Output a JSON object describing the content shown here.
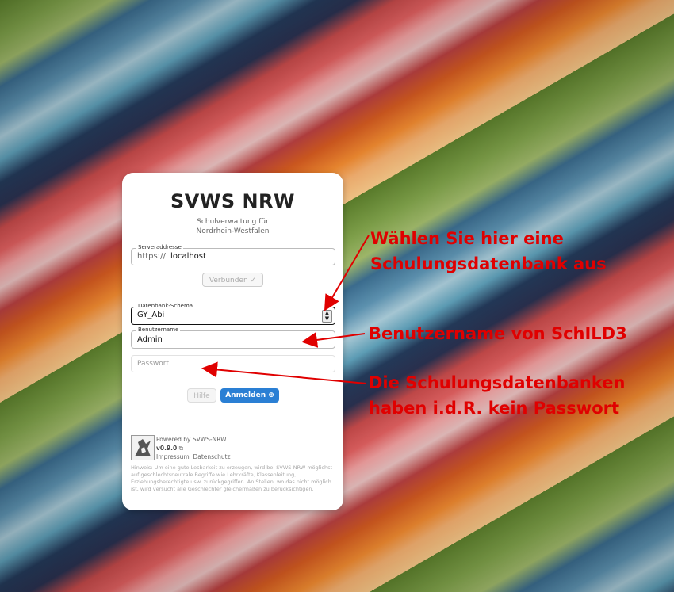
{
  "app": {
    "title": "SVWS NRW",
    "subtitle": "Schulverwaltung für\nNordrhein-Westfalen"
  },
  "server": {
    "label": "Serveraddresse",
    "prefix": "https://",
    "value": "localhost",
    "connect_label": "Verbunden ✓"
  },
  "schema": {
    "label": "Datenbank-Schema",
    "value": "GY_Abi"
  },
  "user": {
    "label": "Benutzername",
    "value": "Admin"
  },
  "password": {
    "placeholder": "Passwort"
  },
  "buttons": {
    "help": "Hilfe",
    "login": "Anmelden ⊕"
  },
  "footer": {
    "powered": "Powered by SVWS-NRW",
    "version": "v0.9.0",
    "imprint": "Impressum",
    "privacy": "Datenschutz"
  },
  "hint": "Hinweis: Um eine gute Lesbarkeit zu erzeugen, wird bei SVWS-NRW möglichst auf geschlechtsneutrale Begriffe wie Lehrkräfte, Klassenleitung, Erziehungsberechtigte usw. zurückgegriffen. An Stellen, wo das nicht möglich ist, wird versucht alle Geschlechter gleichermaßen zu berücksichtigen.",
  "annotations": {
    "schema_note": "Wählen Sie hier eine\nSchulungsdatenbank aus",
    "user_note": "Benutzername von SchILD3",
    "password_note": "Die Schulungsdatenbanken\nhaben i.d.R. kein Passwort"
  },
  "colors": {
    "annotation": "#e00000",
    "primary_button": "#2a7fd4"
  }
}
